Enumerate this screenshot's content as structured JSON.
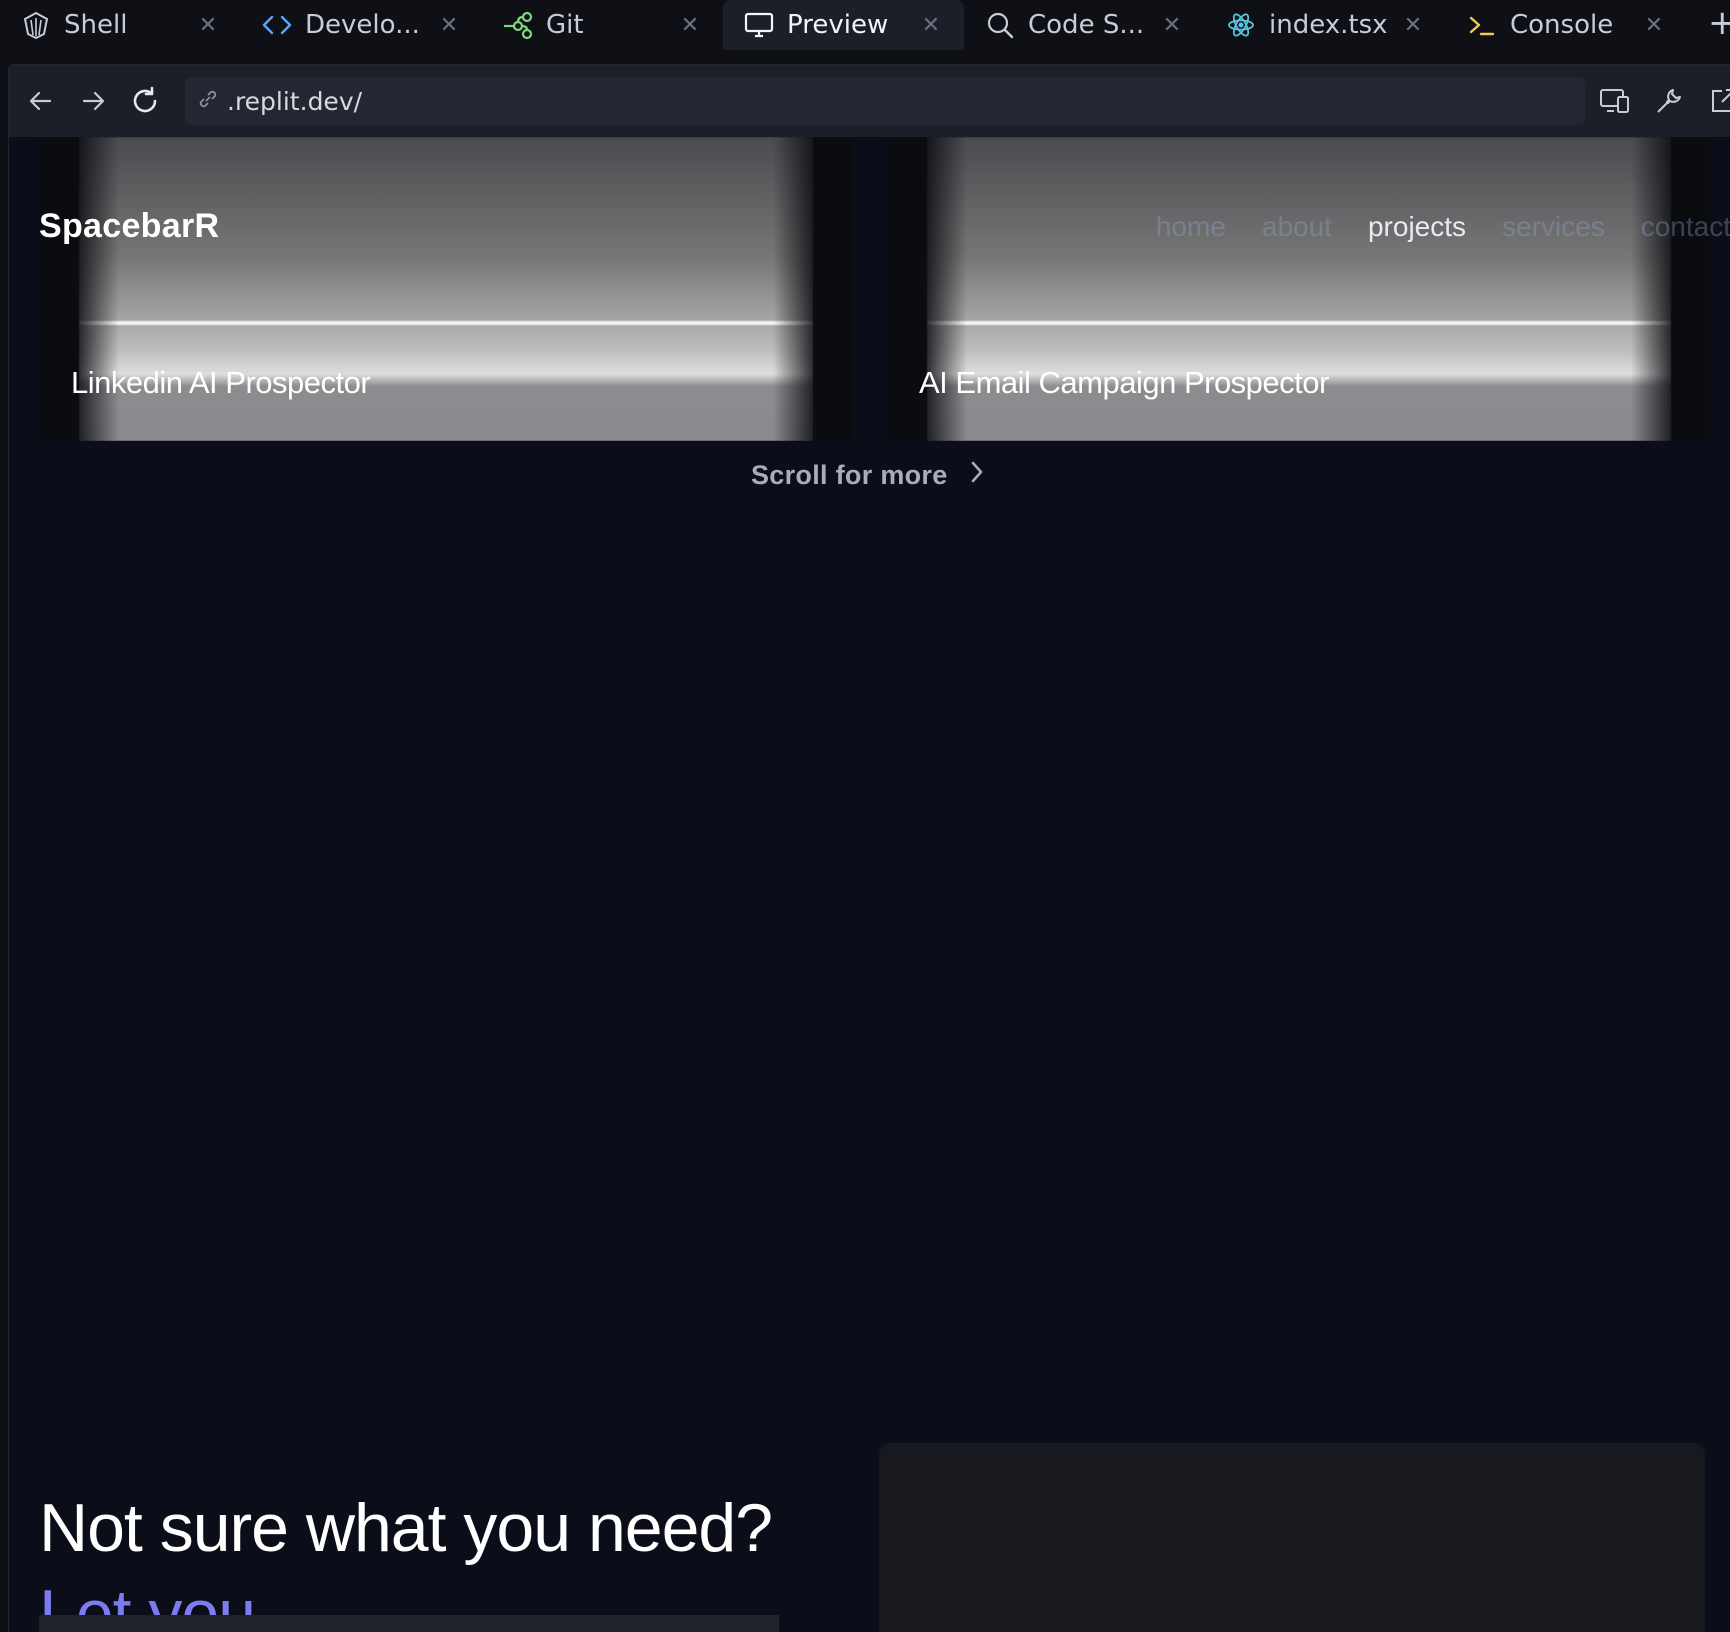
{
  "tabs": [
    {
      "label": "Shell",
      "icon": "shell-icon",
      "active": false
    },
    {
      "label": "Develo...",
      "icon": "code-brackets-icon",
      "active": false
    },
    {
      "label": "Git",
      "icon": "git-branch-icon",
      "active": false
    },
    {
      "label": "Preview",
      "icon": "monitor-icon",
      "active": true
    },
    {
      "label": "Code S...",
      "icon": "search-icon",
      "active": false
    },
    {
      "label": "index.tsx",
      "icon": "react-icon",
      "active": false
    },
    {
      "label": "Console",
      "icon": "terminal-icon",
      "active": false
    }
  ],
  "browser": {
    "url": ".replit.dev/"
  },
  "site": {
    "brand": "SpacebarR",
    "nav": [
      "home",
      "about",
      "projects",
      "services",
      "contact"
    ],
    "nav_active": "projects",
    "cards": [
      {
        "title": "Linkedin AI Prospector"
      },
      {
        "title": "AI Email Campaign Prospector"
      }
    ],
    "scroll_more": "Scroll for more",
    "headline": "Not sure what you need?",
    "subline": "Let you"
  },
  "colors": {
    "accent": "#7b7cf0",
    "page_bg": "#0b0d18",
    "tab_active_bg": "#1c1f27"
  }
}
